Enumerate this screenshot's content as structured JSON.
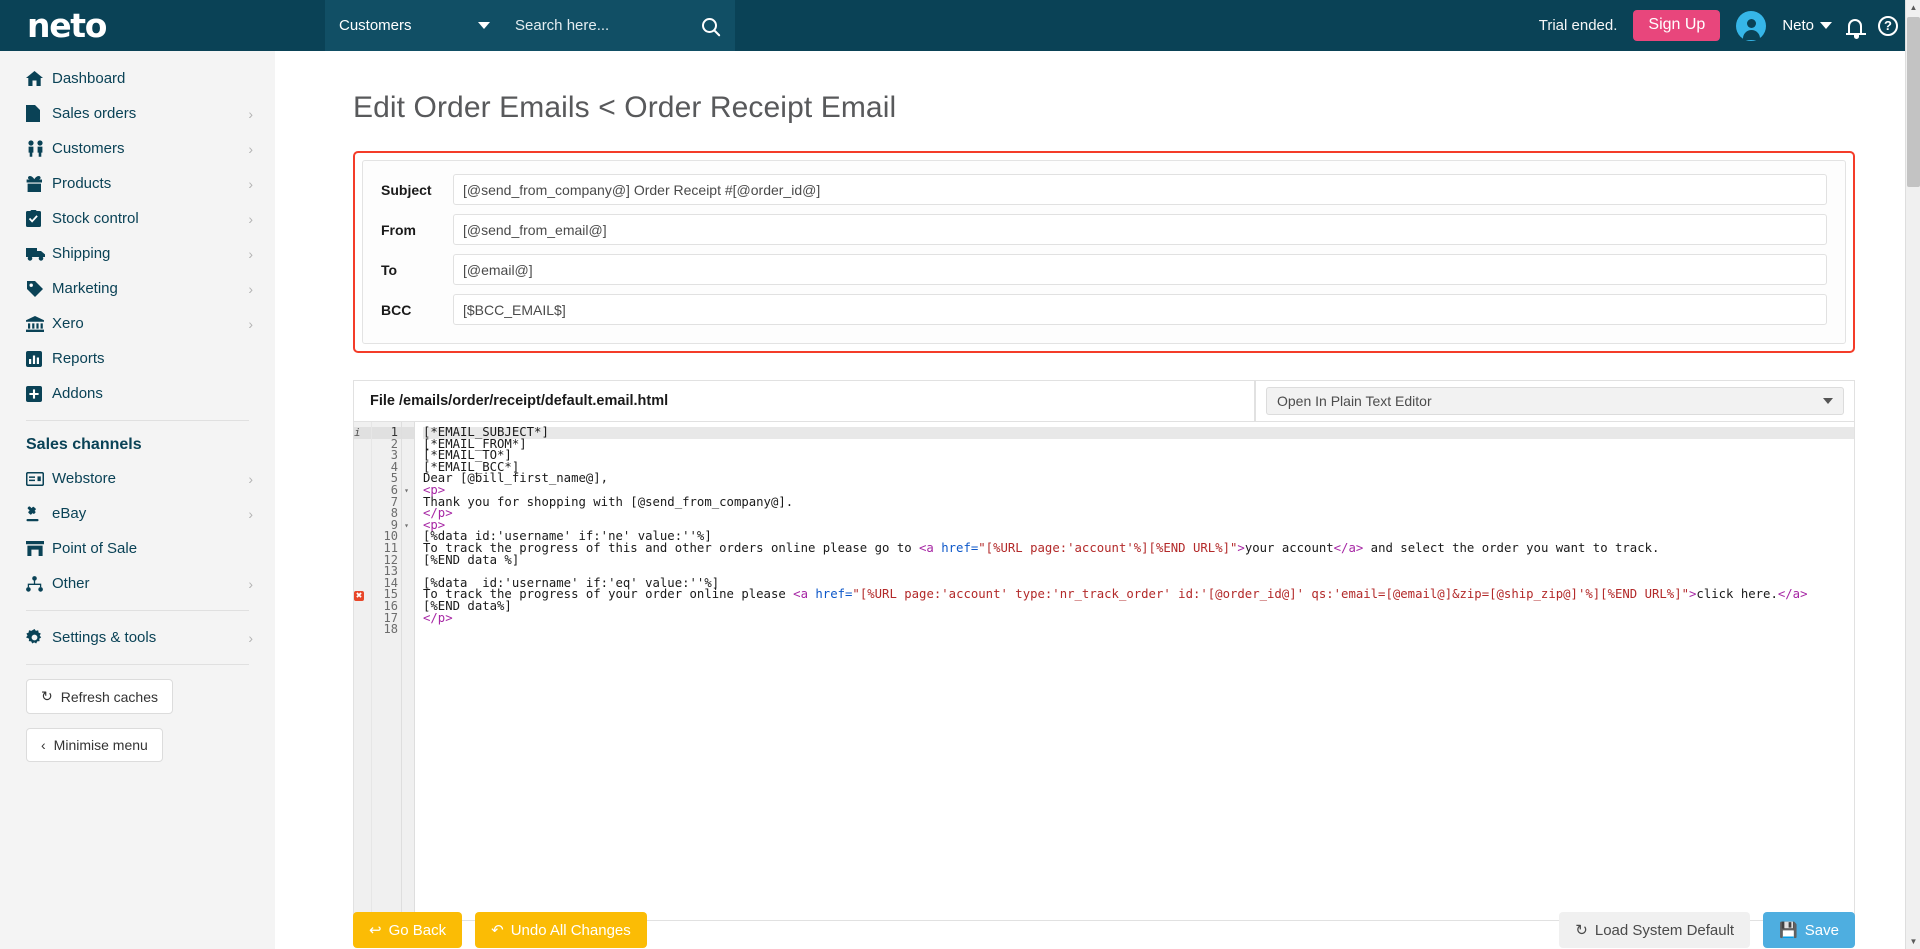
{
  "header": {
    "logo_text": "neto",
    "search_category": "Customers",
    "search_placeholder": "Search here...",
    "trial_text": "Trial ended.",
    "signup_label": "Sign Up",
    "account_name": "Neto",
    "accent_pink": "#e8467c",
    "header_bg": "#0a4256"
  },
  "sidebar": {
    "items": [
      {
        "label": "Dashboard",
        "icon": "home-icon",
        "chevron": false
      },
      {
        "label": "Sales orders",
        "icon": "document-icon",
        "chevron": true
      },
      {
        "label": "Customers",
        "icon": "people-icon",
        "chevron": true
      },
      {
        "label": "Products",
        "icon": "gift-icon",
        "chevron": true
      },
      {
        "label": "Stock control",
        "icon": "clipboard-check-icon",
        "chevron": true
      },
      {
        "label": "Shipping",
        "icon": "truck-icon",
        "chevron": true
      },
      {
        "label": "Marketing",
        "icon": "tag-icon",
        "chevron": true
      },
      {
        "label": "Xero",
        "icon": "bank-icon",
        "chevron": true
      },
      {
        "label": "Reports",
        "icon": "bar-chart-icon",
        "chevron": false
      },
      {
        "label": "Addons",
        "icon": "plus-square-icon",
        "chevron": false
      }
    ],
    "section_heading": "Sales channels",
    "channels": [
      {
        "label": "Webstore",
        "icon": "browser-icon",
        "chevron": true
      },
      {
        "label": "eBay",
        "icon": "gavel-icon",
        "chevron": true
      },
      {
        "label": "Point of Sale",
        "icon": "shop-icon",
        "chevron": false
      },
      {
        "label": "Other",
        "icon": "sitemap-icon",
        "chevron": true
      }
    ],
    "settings": {
      "label": "Settings & tools",
      "icon": "gear-icon",
      "chevron": true
    },
    "refresh_caches_label": "Refresh caches",
    "minimise_menu_label": "Minimise menu"
  },
  "main": {
    "page_title": "Edit Order Emails < Order Receipt Email",
    "fields": [
      {
        "label": "Subject",
        "value": "[@send_from_company@] Order Receipt #[@order_id@]"
      },
      {
        "label": "From",
        "value": "[@send_from_email@]"
      },
      {
        "label": "To",
        "value": "[@email@]"
      },
      {
        "label": "BCC",
        "value": "[$BCC_EMAIL$]"
      }
    ],
    "file_label": "File /emails/order/receipt/default.email.html",
    "editor_select_value": "Open In Plain Text Editor",
    "highlight_border_color": "#f43c29"
  },
  "editor": {
    "lines": [
      {
        "n": 1,
        "marker": "info",
        "fold": "",
        "highlight": true,
        "segments": [
          {
            "t": "[*EMAIL_SUBJECT*]",
            "c": "punc"
          }
        ]
      },
      {
        "n": 2,
        "marker": "",
        "fold": "",
        "highlight": false,
        "segments": [
          {
            "t": "[*EMAIL_FROM*]",
            "c": "punc"
          }
        ]
      },
      {
        "n": 3,
        "marker": "",
        "fold": "",
        "highlight": false,
        "segments": [
          {
            "t": "[*EMAIL_TO*]",
            "c": "punc"
          }
        ]
      },
      {
        "n": 4,
        "marker": "",
        "fold": "",
        "highlight": false,
        "segments": [
          {
            "t": "[*EMAIL_BCC*]",
            "c": "punc"
          }
        ]
      },
      {
        "n": 5,
        "marker": "",
        "fold": "",
        "highlight": false,
        "segments": [
          {
            "t": "Dear [@bill_first_name@],",
            "c": "punc"
          }
        ]
      },
      {
        "n": 6,
        "marker": "",
        "fold": "▾",
        "highlight": false,
        "segments": [
          {
            "t": "<p>",
            "c": "tag"
          }
        ]
      },
      {
        "n": 7,
        "marker": "",
        "fold": "",
        "highlight": false,
        "segments": [
          {
            "t": "Thank you for shopping with [@send_from_company@].",
            "c": "punc"
          }
        ]
      },
      {
        "n": 8,
        "marker": "",
        "fold": "",
        "highlight": false,
        "segments": [
          {
            "t": "</p>",
            "c": "tag"
          }
        ]
      },
      {
        "n": 9,
        "marker": "",
        "fold": "▾",
        "highlight": false,
        "segments": [
          {
            "t": "<p>",
            "c": "tag"
          }
        ]
      },
      {
        "n": 10,
        "marker": "",
        "fold": "",
        "highlight": false,
        "segments": [
          {
            "t": "[%data id:'username' if:'ne' value:''%]",
            "c": "punc"
          }
        ]
      },
      {
        "n": 11,
        "marker": "",
        "fold": "",
        "highlight": false,
        "segments": [
          {
            "t": "To track the progress of this and other orders online please go to ",
            "c": "punc"
          },
          {
            "t": "<a ",
            "c": "tag"
          },
          {
            "t": "href=",
            "c": "attr"
          },
          {
            "t": "\"[%URL page:'account'%][%END URL%]\"",
            "c": "str"
          },
          {
            "t": ">",
            "c": "tag"
          },
          {
            "t": "your account",
            "c": "punc"
          },
          {
            "t": "</a>",
            "c": "tag"
          },
          {
            "t": " and select the order you want to track.",
            "c": "punc"
          }
        ]
      },
      {
        "n": 12,
        "marker": "",
        "fold": "",
        "highlight": false,
        "segments": [
          {
            "t": "[%END data %]",
            "c": "punc"
          }
        ]
      },
      {
        "n": 13,
        "marker": "",
        "fold": "",
        "highlight": false,
        "segments": [
          {
            "t": "",
            "c": "punc"
          }
        ]
      },
      {
        "n": 14,
        "marker": "",
        "fold": "",
        "highlight": false,
        "segments": [
          {
            "t": "[%data  id:'username' if:'eq' value:''%]",
            "c": "punc"
          }
        ]
      },
      {
        "n": 15,
        "marker": "error",
        "fold": "",
        "highlight": false,
        "segments": [
          {
            "t": "To track the progress of your order online please ",
            "c": "punc"
          },
          {
            "t": "<a ",
            "c": "tag"
          },
          {
            "t": "href=",
            "c": "attr"
          },
          {
            "t": "\"[%URL page:'account' type:'nr_track_order' id:'[@order_id@]' qs:'email=[@email@]&zip=[@ship_zip@]'%][%END URL%]\"",
            "c": "str"
          },
          {
            "t": ">",
            "c": "tag"
          },
          {
            "t": "click here.",
            "c": "punc"
          },
          {
            "t": "</a>",
            "c": "tag"
          }
        ]
      },
      {
        "n": 16,
        "marker": "",
        "fold": "",
        "highlight": false,
        "segments": [
          {
            "t": "[%END data%]",
            "c": "punc"
          }
        ]
      },
      {
        "n": 17,
        "marker": "",
        "fold": "",
        "highlight": false,
        "segments": [
          {
            "t": "</p>",
            "c": "tag"
          }
        ]
      },
      {
        "n": 18,
        "marker": "",
        "fold": "",
        "highlight": false,
        "segments": [
          {
            "t": "",
            "c": "punc"
          }
        ]
      }
    ]
  },
  "footer": {
    "go_back_label": "Go Back",
    "undo_all_label": "Undo All Changes",
    "load_default_label": "Load System Default",
    "save_label": "Save"
  }
}
